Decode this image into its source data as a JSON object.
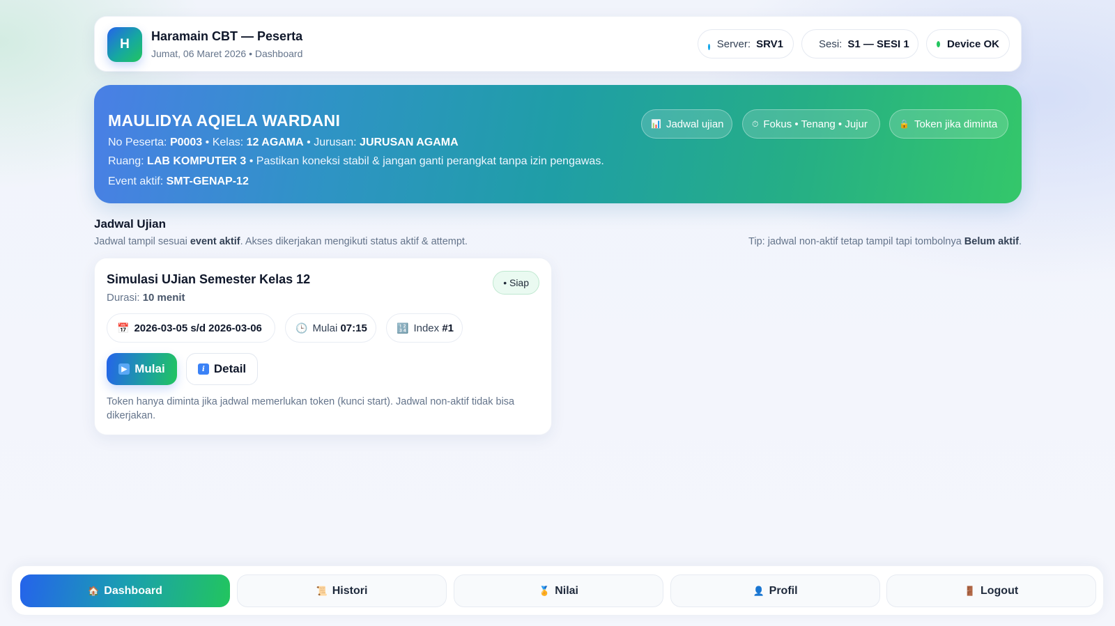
{
  "header": {
    "logo_letter": "H",
    "title": "Haramain CBT — Peserta",
    "subtitle": "Jumat, 06 Maret 2026 • Dashboard",
    "server_label": "Server:",
    "server_value": "SRV1",
    "sesi_label": "Sesi:",
    "sesi_value": "S1 — SESI 1",
    "device_status": "Device OK"
  },
  "hero": {
    "name": "MAULIDYA AQIELA WARDANI",
    "no_peserta_label": "No Peserta:",
    "no_peserta": "P0003",
    "kelas_label": "• Kelas:",
    "kelas": "12 AGAMA",
    "jurusan_label": "• Jurusan:",
    "jurusan": "JURUSAN AGAMA",
    "ruang_label": "Ruang:",
    "ruang": "LAB KOMPUTER 3",
    "ruang_note": "• Pastikan koneksi stabil & jangan ganti perangkat tanpa izin pengawas.",
    "event_label": "Event aktif:",
    "event": "SMT-GENAP-12",
    "chips": [
      "Jadwal ujian",
      "Fokus • Tenang • Jujur",
      "Token jika diminta"
    ]
  },
  "section": {
    "title": "Jadwal Ujian",
    "desc_pre": "Jadwal tampil sesuai",
    "desc_bold": "event aktif",
    "desc_post": ". Akses dikerjakan mengikuti status aktif & attempt.",
    "tip_pre": "Tip: jadwal non-aktif tetap tampil tapi tombolnya",
    "tip_bold": "Belum aktif",
    "tip_post": "."
  },
  "exam": {
    "title": "Simulasi UJian Semester Kelas 12",
    "durasi_label": "Durasi:",
    "durasi": "10 menit",
    "status": "• Siap",
    "tanggal": "2026-03-05 s/d 2026-03-06",
    "mulai_label": "Mulai",
    "mulai_time": "07:15",
    "index_label": "Index",
    "index_value": "#1",
    "btn_mulai": "Mulai",
    "btn_detail": "Detail",
    "note": "Token hanya diminta jika jadwal memerlukan token (kunci start). Jadwal non-aktif tidak bisa dikerjakan."
  },
  "nav": {
    "items": [
      {
        "label": "Dashboard",
        "icon": "home-icon"
      },
      {
        "label": "Histori",
        "icon": "scroll-icon"
      },
      {
        "label": "Nilai",
        "icon": "medal-icon"
      },
      {
        "label": "Profil",
        "icon": "user-icon"
      },
      {
        "label": "Logout",
        "icon": "door-icon"
      }
    ],
    "active_index": 0
  },
  "colors": {
    "accent_blue": "#2563eb",
    "accent_green": "#22c55e",
    "server_dot": "#0ea5e9",
    "ok_dot": "#22c55e"
  }
}
